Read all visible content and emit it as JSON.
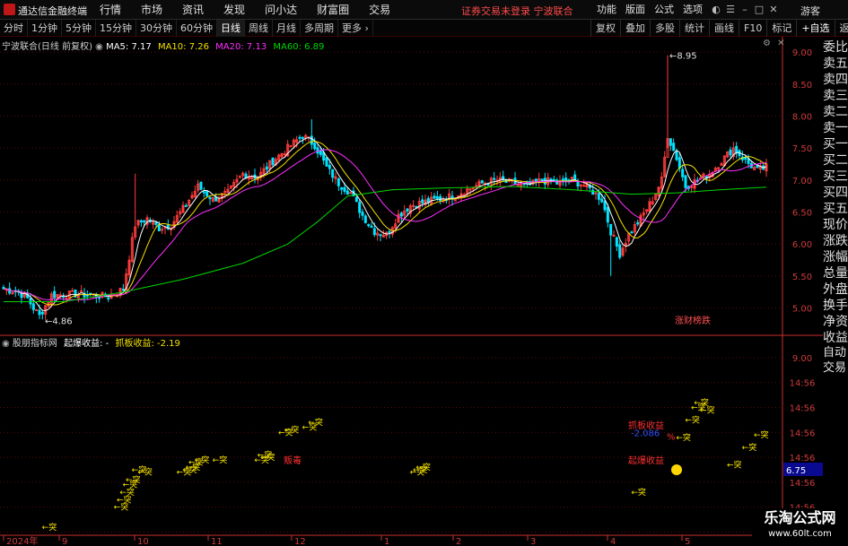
{
  "app": {
    "name": "通达信金融终端",
    "menu": [
      "行情",
      "市场",
      "资讯",
      "发现",
      "问小达",
      "财富圈",
      "交易"
    ],
    "login_status": "证券交易未登录  宁波联合",
    "right_menu": [
      "功能",
      "版面",
      "公式",
      "选项"
    ],
    "guest": "游客"
  },
  "toolbar": {
    "periods": [
      "分时",
      "1分钟",
      "5分钟",
      "15分钟",
      "30分钟",
      "60分钟",
      "日线",
      "周线",
      "月线",
      "多周期",
      "更多"
    ],
    "active_period": "日线",
    "tools": [
      "复权",
      "叠加",
      "多股",
      "统计",
      "画线",
      "F10",
      "标记",
      "+自选",
      "返回"
    ]
  },
  "quote_panel": [
    "委比",
    "卖五",
    "卖四",
    "卖三",
    "卖二",
    "卖一",
    "买一",
    "买二",
    "买三",
    "买四",
    "买五",
    "现价",
    "涨跌",
    "涨幅",
    "总量",
    "外盘",
    "换手",
    "净资",
    "收益"
  ],
  "lower_side": {
    "items": [
      "自动",
      "交易"
    ],
    "highlight_value": "6.75"
  },
  "watermark": {
    "main": "乐淘公式网",
    "sub": "www.60lt.com"
  },
  "colors": {
    "up": "#ff3c3c",
    "down": "#00e5ff",
    "ma5": "#ffffff",
    "ma10": "#f5e100",
    "ma20": "#ff2fff",
    "ma60": "#00d700",
    "grid": "#5a0a0a",
    "axis": "#cc3030"
  },
  "chart_data": [
    {
      "type": "candlestick",
      "title": "宁波联合(日线 前复权)",
      "legend": [
        {
          "name": "MA5",
          "value": "7.17"
        },
        {
          "name": "MA10",
          "value": "7.26"
        },
        {
          "name": "MA20",
          "value": "7.13"
        },
        {
          "name": "MA60",
          "value": "6.89"
        }
      ],
      "ylim": [
        4.7,
        9.1
      ],
      "yticks": [
        5.0,
        5.5,
        6.0,
        6.5,
        7.0,
        7.5,
        8.0,
        8.5,
        9.0
      ],
      "annotations": [
        {
          "label": "4.86",
          "value": 4.86
        },
        {
          "label": "8.95",
          "value": 8.95
        }
      ],
      "tag_label": "涨财榜跌",
      "xticks": [
        "2024年",
        "9",
        "10",
        "11",
        "12",
        "1",
        "2",
        "3",
        "4",
        "5"
      ],
      "anchors": [
        [
          0,
          5.3
        ],
        [
          5,
          5.25
        ],
        [
          8,
          5.15
        ],
        [
          10,
          5.0
        ],
        [
          12,
          4.88
        ],
        [
          16,
          5.2
        ],
        [
          25,
          5.22
        ],
        [
          35,
          5.18
        ],
        [
          40,
          5.3
        ],
        [
          44,
          6.3
        ],
        [
          48,
          6.4
        ],
        [
          52,
          6.25
        ],
        [
          56,
          6.3
        ],
        [
          60,
          6.55
        ],
        [
          65,
          6.9
        ],
        [
          70,
          6.7
        ],
        [
          75,
          6.8
        ],
        [
          80,
          7.1
        ],
        [
          85,
          7.05
        ],
        [
          90,
          7.3
        ],
        [
          95,
          7.5
        ],
        [
          100,
          7.7
        ],
        [
          104,
          7.55
        ],
        [
          108,
          7.2
        ],
        [
          112,
          6.95
        ],
        [
          116,
          6.8
        ],
        [
          120,
          6.45
        ],
        [
          124,
          6.2
        ],
        [
          128,
          6.15
        ],
        [
          132,
          6.45
        ],
        [
          136,
          6.6
        ],
        [
          140,
          6.65
        ],
        [
          145,
          6.7
        ],
        [
          150,
          6.75
        ],
        [
          155,
          6.85
        ],
        [
          160,
          6.95
        ],
        [
          165,
          7.0
        ],
        [
          170,
          6.95
        ],
        [
          175,
          6.9
        ],
        [
          180,
          7.0
        ],
        [
          185,
          6.95
        ],
        [
          190,
          7.0
        ],
        [
          195,
          6.9
        ],
        [
          200,
          6.7
        ],
        [
          203,
          6.2
        ],
        [
          206,
          5.85
        ],
        [
          209,
          6.15
        ],
        [
          213,
          6.4
        ],
        [
          217,
          6.7
        ],
        [
          220,
          7.0
        ],
        [
          222,
          7.7
        ],
        [
          225,
          7.35
        ],
        [
          228,
          6.9
        ],
        [
          232,
          7.0
        ],
        [
          236,
          7.1
        ],
        [
          240,
          7.3
        ],
        [
          244,
          7.5
        ],
        [
          248,
          7.3
        ],
        [
          252,
          7.15
        ],
        [
          255,
          7.2
        ]
      ],
      "bars": 256,
      "ma60": [
        [
          0,
          5.1
        ],
        [
          20,
          5.1
        ],
        [
          40,
          5.25
        ],
        [
          60,
          5.45
        ],
        [
          80,
          5.7
        ],
        [
          95,
          6.0
        ],
        [
          105,
          6.35
        ],
        [
          115,
          6.75
        ],
        [
          130,
          6.85
        ],
        [
          150,
          6.88
        ],
        [
          170,
          6.9
        ],
        [
          190,
          6.85
        ],
        [
          210,
          6.78
        ],
        [
          225,
          6.8
        ],
        [
          240,
          6.85
        ],
        [
          255,
          6.89
        ]
      ]
    },
    {
      "type": "scatter",
      "title": "股朋指标网",
      "legend": [
        {
          "name": "起爆收益",
          "value": "-"
        },
        {
          "name": "抓板收益",
          "value": "-2.19"
        }
      ],
      "marker_label": "突",
      "ylim": [
        5.4,
        9.25
      ],
      "yticks": [
        5.5,
        6.0,
        6.5,
        7.0,
        7.5,
        8.0,
        8.5,
        9.0
      ],
      "ytick_labels": [
        "14:56",
        "14:56",
        "14:56",
        "14:56",
        "14:56",
        "14:56",
        "14:56",
        "9.00"
      ],
      "x_categories": [
        "9",
        "10",
        "11",
        "12",
        "1",
        "2",
        "3",
        "4",
        "5"
      ],
      "points": [
        [
          17,
          5.6
        ],
        [
          41,
          6.0
        ],
        [
          42,
          6.15
        ],
        [
          43,
          6.3
        ],
        [
          44,
          6.45
        ],
        [
          45,
          6.55
        ],
        [
          47,
          6.75
        ],
        [
          49,
          6.7
        ],
        [
          62,
          6.7
        ],
        [
          64,
          6.75
        ],
        [
          65,
          6.8
        ],
        [
          66,
          6.9
        ],
        [
          68,
          6.95
        ],
        [
          74,
          6.95
        ],
        [
          88,
          6.95
        ],
        [
          89,
          7.05
        ],
        [
          90,
          7.0
        ],
        [
          96,
          7.5
        ],
        [
          98,
          7.55
        ],
        [
          104,
          7.6
        ],
        [
          106,
          7.7
        ],
        [
          140,
          6.7
        ],
        [
          141,
          6.75
        ],
        [
          142,
          6.8
        ],
        [
          214,
          6.3
        ],
        [
          229,
          7.4
        ],
        [
          232,
          7.75
        ],
        [
          234,
          8.0
        ],
        [
          235,
          8.1
        ],
        [
          237,
          7.95
        ],
        [
          246,
          6.85
        ],
        [
          251,
          7.2
        ],
        [
          258,
          7.45
        ]
      ],
      "labels": [
        {
          "text": "抓板收益",
          "value": 7.65
        },
        {
          "text": "-2.086",
          "value": 7.5
        },
        {
          "text": "起爆收益",
          "value": 6.95
        },
        {
          "text": "贩毒",
          "value": 6.95
        },
        {
          "text": "%",
          "value": 7.42
        }
      ]
    }
  ]
}
